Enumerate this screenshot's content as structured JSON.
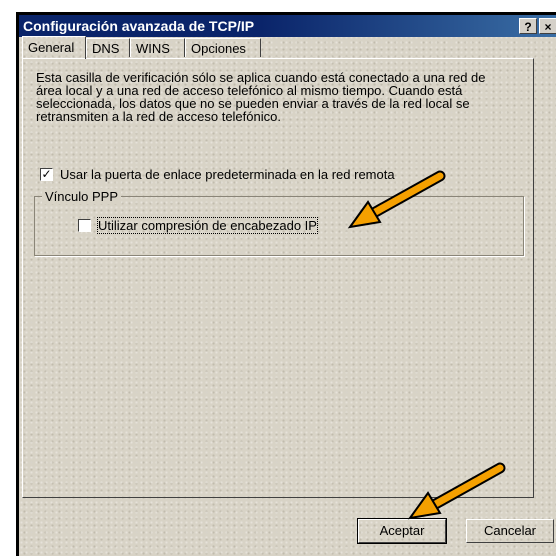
{
  "window": {
    "title": "Configuración avanzada de TCP/IP",
    "help_label": "?",
    "close_label": "×"
  },
  "tabs": [
    {
      "label": "General",
      "active": true
    },
    {
      "label": "DNS",
      "active": false
    },
    {
      "label": "WINS",
      "active": false
    },
    {
      "label": "Opciones",
      "active": false
    }
  ],
  "general": {
    "description": "Esta casilla de verificación sólo se aplica cuando está conectado a una red de área local y a una red de acceso telefónico al mismo tiempo. Cuando está seleccionada, los datos que no se pueden enviar a través de la red local se retransmiten a la red de acceso telefónico.",
    "use_gateway": {
      "label": "Usar la puerta de enlace predeterminada en la red remota",
      "checked": true,
      "check_mark": "✓"
    },
    "ppp_group": {
      "title": "Vínculo PPP",
      "compression": {
        "label": "Utilizar compresión de encabezado IP",
        "checked": false
      }
    }
  },
  "buttons": {
    "ok": "Aceptar",
    "cancel": "Cancelar"
  },
  "annotations": {
    "arrow_color": "#f5a000"
  }
}
